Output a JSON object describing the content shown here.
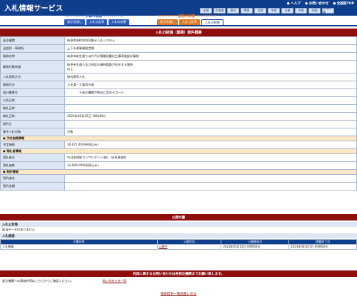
{
  "header": {
    "app_title": "入札情報サービス",
    "links": [
      "● ヘルプ",
      "● お問い合わせ",
      "● 全国版TOP"
    ],
    "regions": [
      "全国",
      "北海道",
      "東北",
      "関東",
      "北陸",
      "中部",
      "近畿",
      "中国",
      "四国",
      "九州沖縄"
    ]
  },
  "categories": [
    {
      "title": "工事の検索",
      "color": "#2b5cb8",
      "tabs": [
        {
          "label": "発注見通し",
          "active": false
        },
        {
          "label": "入札公告等",
          "active": false
        },
        {
          "label": "入札の結果",
          "active": false
        }
      ]
    },
    {
      "title": "業務の検索",
      "color": "#e0781f",
      "tabs": [
        {
          "label": "発注見通し",
          "active": false
        },
        {
          "label": "入札公告等",
          "active": false
        },
        {
          "label": "入札の結果",
          "active": true
        }
      ]
    }
  ],
  "form": {
    "title": "入札の経過（業務）案件概要",
    "rows": [
      {
        "label": "発注機関",
        "value": "岐阜県市町村共同電子入札システム"
      },
      {
        "label": "当該部・事務所",
        "value": "上下水道事業経営課"
      },
      {
        "label": "業務名称",
        "value": "岐阜市新生通りほか汚水管路耐震化工事実施設計業務"
      },
      {
        "label": "業務対象地域",
        "value": "岐阜市生通り及び地区の基幹管路が存在する場所\n以上",
        "tall": true
      },
      {
        "label": "入札契約方式",
        "value": "指名競争入札"
      },
      {
        "label": "業務区分",
        "value": "上水道・工業用水道"
      },
      {
        "label": "設計書番号",
        "value": "　　　　＊発注機関が独自に定めるコード"
      },
      {
        "label": "公告日時",
        "value": ""
      },
      {
        "label": "開札日時",
        "value": ""
      },
      {
        "label": "開札日時",
        "value": "2023年05月25日 10時30分"
      },
      {
        "label": "契約日",
        "value": ""
      },
      {
        "label": "電子入札対象",
        "value": "対象"
      },
      {
        "section": "● 予定価格情報"
      },
      {
        "label": "予定価格",
        "value": "30,077,400円(税込み)"
      },
      {
        "section": "● 落札者情報"
      },
      {
        "label": "落札者名",
        "value": "中日本建設コンサルタント(株)　岐阜事務所"
      },
      {
        "label": "落札価格",
        "value": "32,000,000円(税込み)"
      },
      {
        "section": "● 契約情報"
      },
      {
        "label": "契約者名",
        "value": ""
      },
      {
        "label": "契約金額",
        "value": ""
      }
    ]
  },
  "public_docs": {
    "title": "公開文書",
    "notice_heading": "入札公告等",
    "notice_empty": "該当データはありません",
    "results_heading": "入札経過",
    "columns": [
      "文書名称",
      "公開状況",
      "公開開始日",
      "掲載終了日"
    ],
    "rows": [
      {
        "name": "入札情報",
        "status": "公開中",
        "start": "2023年05月25日 00時00分",
        "end": "2023年06月01日 00時00分"
      }
    ]
  },
  "contact": {
    "title": "内容に関するお問い合わせは各発注機関までお願い致します。",
    "text": "発注機関への連絡先等はこちらからご確認ください。",
    "link": "問い合わせ先一覧"
  },
  "back_link": "検索結果一覧画面に戻る"
}
